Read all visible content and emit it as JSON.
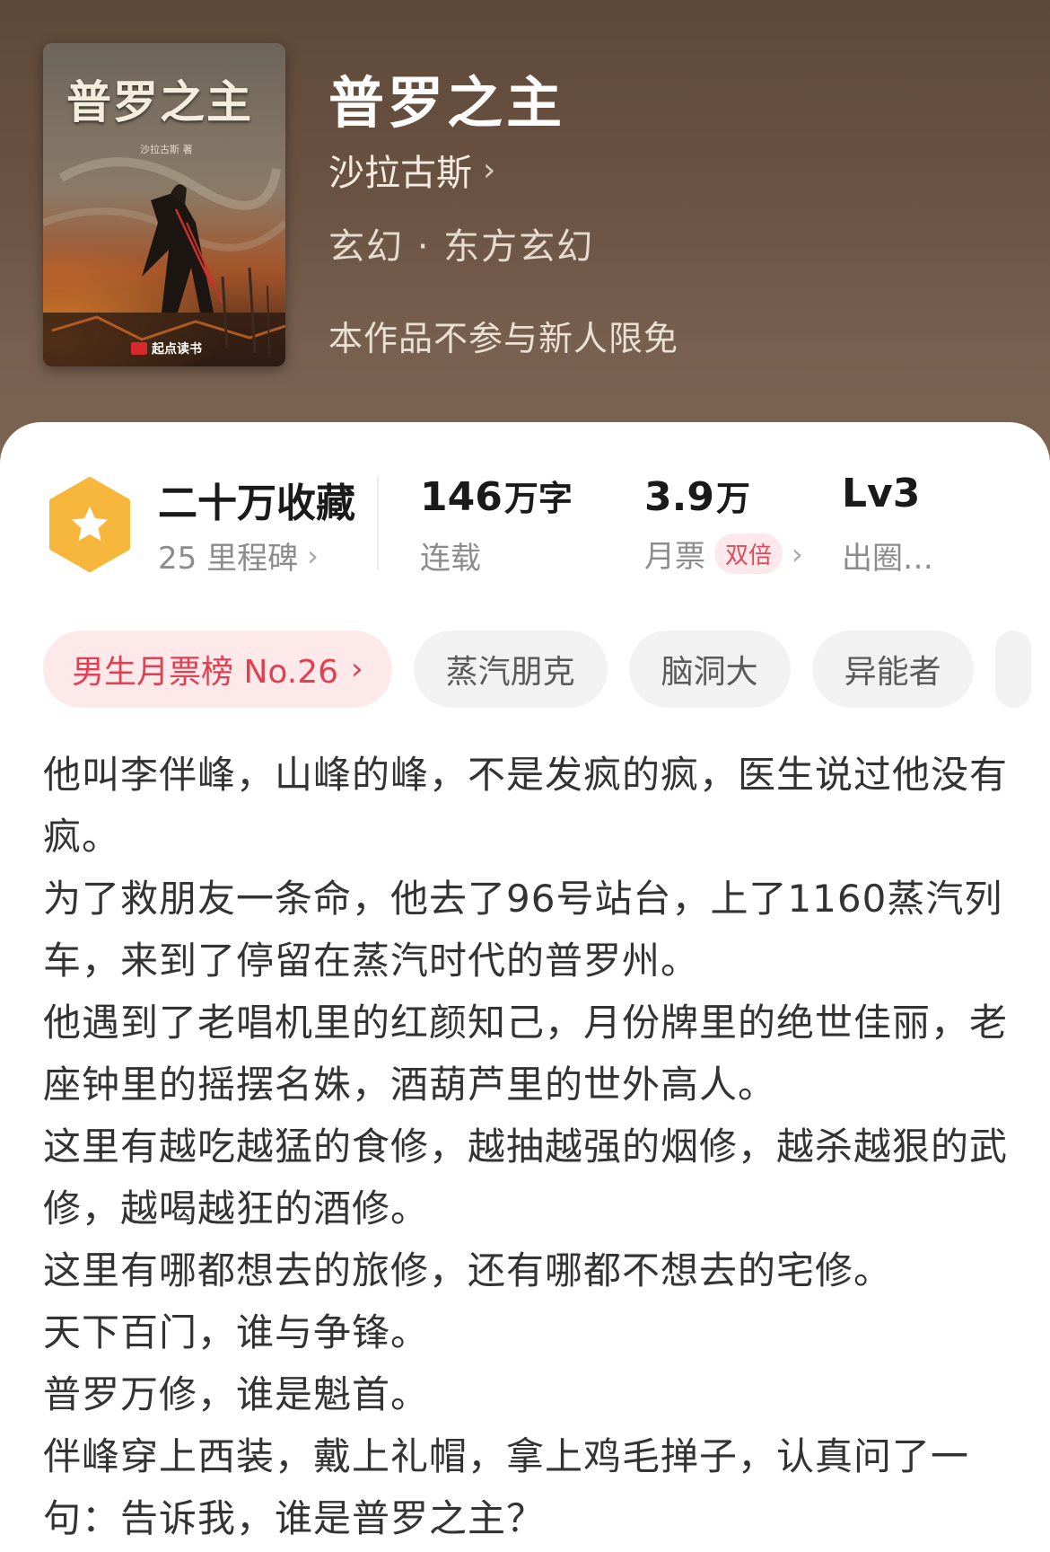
{
  "book": {
    "title": "普罗之主",
    "author": "沙拉古斯",
    "genre": "玄幻 · 东方玄幻",
    "notice": "本作品不参与新人限免"
  },
  "cover": {
    "title": "普罗之主",
    "author": "沙拉古斯 著",
    "publisher": "起点读书"
  },
  "stats": {
    "favorites": {
      "value": "二十万收藏",
      "sub": "25 里程碑"
    },
    "words": {
      "value": "146",
      "unit": "万字",
      "sub": "连载"
    },
    "monthly_ticket": {
      "value": "3.9",
      "unit": "万",
      "sub": "月票",
      "tag": "双倍"
    },
    "level": {
      "value": "Lv3",
      "sub": "出圈…"
    }
  },
  "tags": {
    "rank": "男生月票榜 No.26",
    "items": [
      "蒸汽朋克",
      "脑洞大",
      "异能者"
    ]
  },
  "description": [
    "他叫李伴峰，山峰的峰，不是发疯的疯，医生说过他没有疯。",
    "为了救朋友一条命，他去了96号站台，上了1160蒸汽列车，来到了停留在蒸汽时代的普罗州。",
    "他遇到了老唱机里的红颜知己，月份牌里的绝世佳丽，老座钟里的摇摆名姝，酒葫芦里的世外高人。",
    "这里有越吃越猛的食修，越抽越强的烟修，越杀越狠的武修，越喝越狂的酒修。",
    "这里有哪都想去的旅修，还有哪都不想去的宅修。",
    "天下百门，谁与争锋。",
    "普罗万修，谁是魁首。",
    "伴峰穿上西装，戴上礼帽，拿上鸡毛掸子，认真问了一句：告诉我，谁是普罗之主？"
  ],
  "icons": {
    "badge": "star-hexagon-icon",
    "chevron": "chevron-right-icon"
  },
  "colors": {
    "header_bg": "#6a5242",
    "badge": "#f6b73c",
    "rank_tag_bg": "#fde9ea",
    "rank_tag_text": "#e13f52"
  }
}
